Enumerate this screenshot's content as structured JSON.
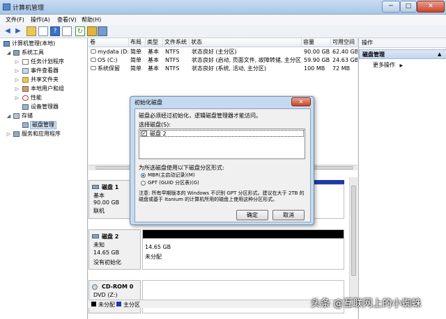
{
  "window": {
    "title": "计算机管理",
    "min": "─",
    "max": "□",
    "close": "✕"
  },
  "menu": [
    "文件(F)",
    "操作(A)",
    "查看(V)",
    "帮助(H)"
  ],
  "tree": {
    "root": "计算机管理(本地)",
    "system_tools": "系统工具",
    "task_scheduler": "任务计划程序",
    "event_viewer": "事件查看器",
    "shared_folders": "共享文件夹",
    "local_users": "本地用户和组",
    "performance": "性能",
    "device_manager": "设备管理器",
    "storage": "存储",
    "disk_management": "磁盘管理",
    "services": "服务和应用程序"
  },
  "volumes": {
    "headers": [
      "卷",
      "布局",
      "类型",
      "文件系统",
      "状态",
      "容量",
      "可用空间"
    ],
    "rows": [
      [
        "mydata (D:)",
        "简单",
        "基本",
        "NTFS",
        "状态良好 (主分区)",
        "90.00 GB",
        "62.40 GB"
      ],
      [
        "OS (C:)",
        "简单",
        "基本",
        "NTFS",
        "状态良好 (启动, 页面文件, 故障转储, 主分区)",
        "59.90 GB",
        "24.63 GB"
      ],
      [
        "系统保留",
        "简单",
        "基本",
        "NTFS",
        "状态良好 (系统, 活动, 主分区)",
        "100 MB",
        "72 MB"
      ]
    ]
  },
  "disks": {
    "disk1": {
      "name": "磁盘 1",
      "type": "基本",
      "size": "90.00 GB",
      "status": "联机"
    },
    "disk2": {
      "name": "磁盘 2",
      "type": "未知",
      "size": "14.65 GB",
      "status": "没有初始化",
      "part_size": "14.65 GB",
      "part_state": "未分配"
    },
    "cdrom": {
      "name": "CD-ROM 0",
      "drive": "DVD (Z:)"
    },
    "legend": [
      "未分配",
      "主分区"
    ]
  },
  "actions": {
    "header": "操作",
    "section": "磁盘管理",
    "more": "更多操作"
  },
  "dialog": {
    "title": "初始化磁盘",
    "intro": "磁盘必须经过初始化，逻辑磁盘管理器才能访问。",
    "select_label": "选择磁盘(S):",
    "disk_item": "磁盘 2",
    "style_label": "为所选磁盘使用以下磁盘分区形式:",
    "mbr": "MBR(主启动记录)(M)",
    "gpt": "GPT (GUID 分区表)(G)",
    "note": "注意: 所有早期版本的 Windows 不识别 GPT 分区形式。建议在大于 2TB 的磁盘或基于 Itanium 的计算机所用的磁盘上使用这种分区形式。",
    "ok": "确定",
    "cancel": "取消",
    "close": "✕"
  },
  "watermark": "头条 @互联网上的小蜘蛛",
  "colors": {
    "unallocated": "#000000",
    "primary": "#1f3aa8",
    "accent": "#3b73c4"
  }
}
